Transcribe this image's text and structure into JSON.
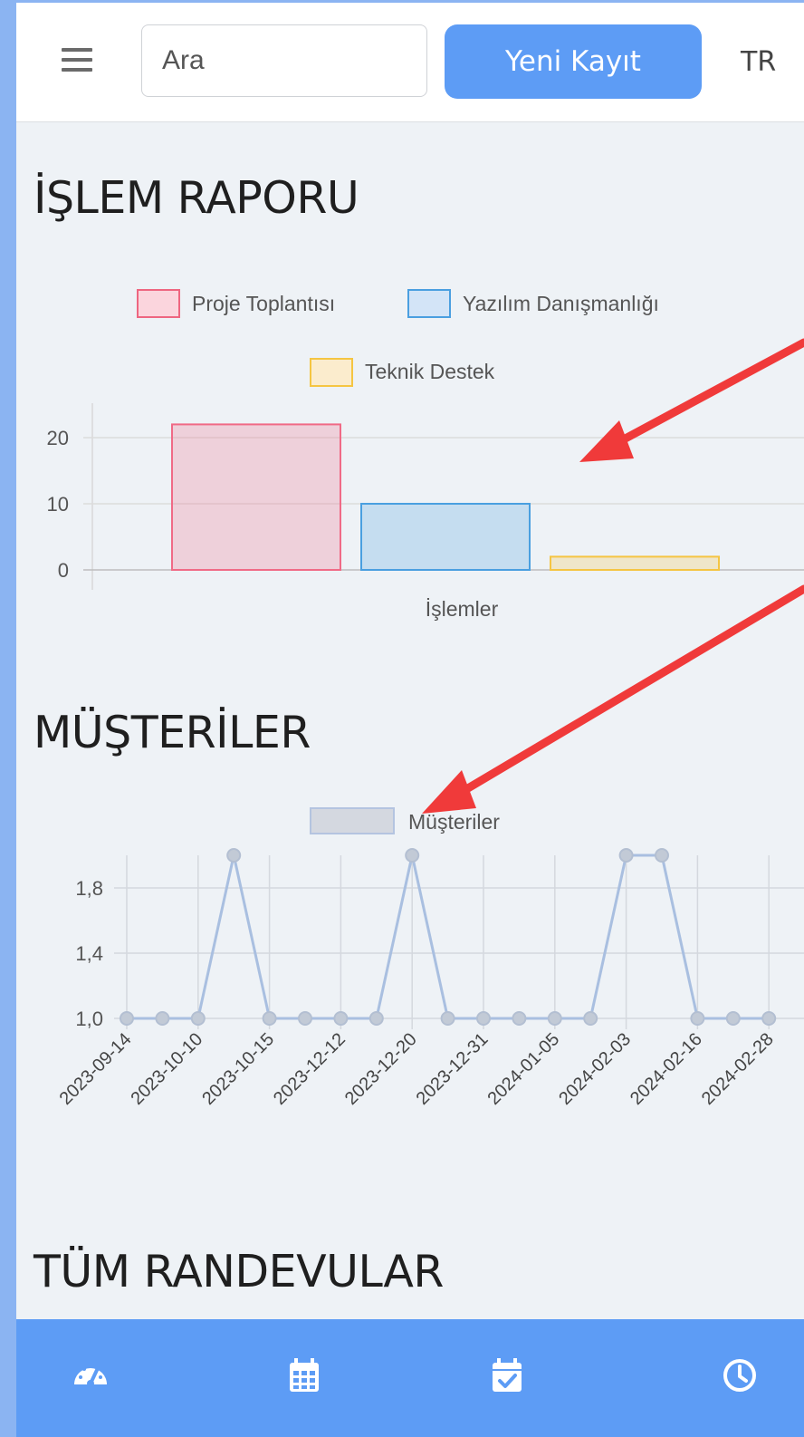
{
  "header": {
    "search_placeholder": "Ara",
    "new_record_label": "Yeni Kayıt",
    "language": "TR",
    "menu_icon": "hamburger-icon"
  },
  "sections": {
    "report_title": "İŞLEM RAPORU",
    "customers_title": "MÜŞTERİLER",
    "appointments_title": "TÜM RANDEVULAR"
  },
  "chart_data": [
    {
      "type": "bar",
      "xlabel": "İşlemler",
      "legend": [
        "Proje Toplantısı",
        "Yazılım Danışmanlığı",
        "Teknik Destek"
      ],
      "legend_position": "top",
      "series": [
        {
          "name": "Proje Toplantısı",
          "values": [
            22
          ],
          "color": "#f06a86"
        },
        {
          "name": "Yazılım Danışmanlığı",
          "values": [
            10
          ],
          "color": "#4a9fe0"
        },
        {
          "name": "Teknik Destek",
          "values": [
            2
          ],
          "color": "#f5c542"
        }
      ],
      "yticks": [
        "0",
        "10",
        "20"
      ],
      "ylim": [
        0,
        25
      ],
      "grid": true
    },
    {
      "type": "line",
      "legend": [
        "Müşteriler"
      ],
      "legend_position": "top",
      "series": [
        {
          "name": "Müşteriler",
          "color": "#a9bfe0",
          "values": [
            1,
            1,
            1,
            2,
            1,
            1,
            1,
            1,
            2,
            1,
            1,
            1,
            1,
            1,
            2,
            2,
            1,
            1,
            1
          ]
        }
      ],
      "x": [
        "2023-09-14",
        "",
        "2023-10-10",
        "",
        "2023-10-15",
        "",
        "2023-12-12",
        "",
        "2023-12-20",
        "",
        "2023-12-31",
        "",
        "2024-01-05",
        "",
        "2024-02-03",
        "",
        "2024-02-16",
        "",
        "2024-02-28"
      ],
      "xtick_labels": [
        "2023-09-14",
        "2023-10-10",
        "2023-10-15",
        "2023-12-12",
        "2023-12-20",
        "2023-12-31",
        "2024-01-05",
        "2024-02-03",
        "2024-02-16",
        "2024-02-28"
      ],
      "yticks": [
        "1,0",
        "1,4",
        "1,8"
      ],
      "ylim": [
        1,
        2
      ],
      "grid": true
    }
  ],
  "annotations": {
    "arrow_color": "#f03a3a"
  },
  "bottom_nav": {
    "items": [
      {
        "icon": "dashboard-gauge-icon"
      },
      {
        "icon": "calendar-grid-icon"
      },
      {
        "icon": "calendar-check-icon"
      },
      {
        "icon": "clock-icon"
      }
    ]
  }
}
